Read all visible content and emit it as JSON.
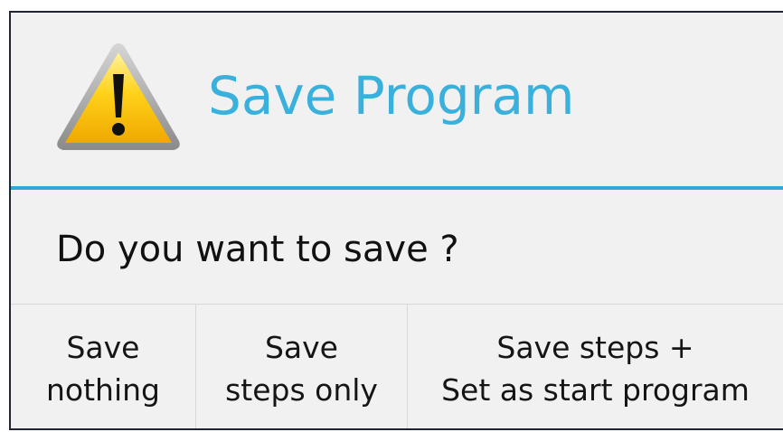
{
  "dialog": {
    "title": "Save Program",
    "message": "Do you want to save ?",
    "icon": "warning-icon",
    "accent_color": "#3ab0dc",
    "buttons": [
      {
        "label": "Save\nnothing"
      },
      {
        "label": "Save\nsteps only"
      },
      {
        "label": "Save steps +\nSet as start program"
      }
    ]
  }
}
